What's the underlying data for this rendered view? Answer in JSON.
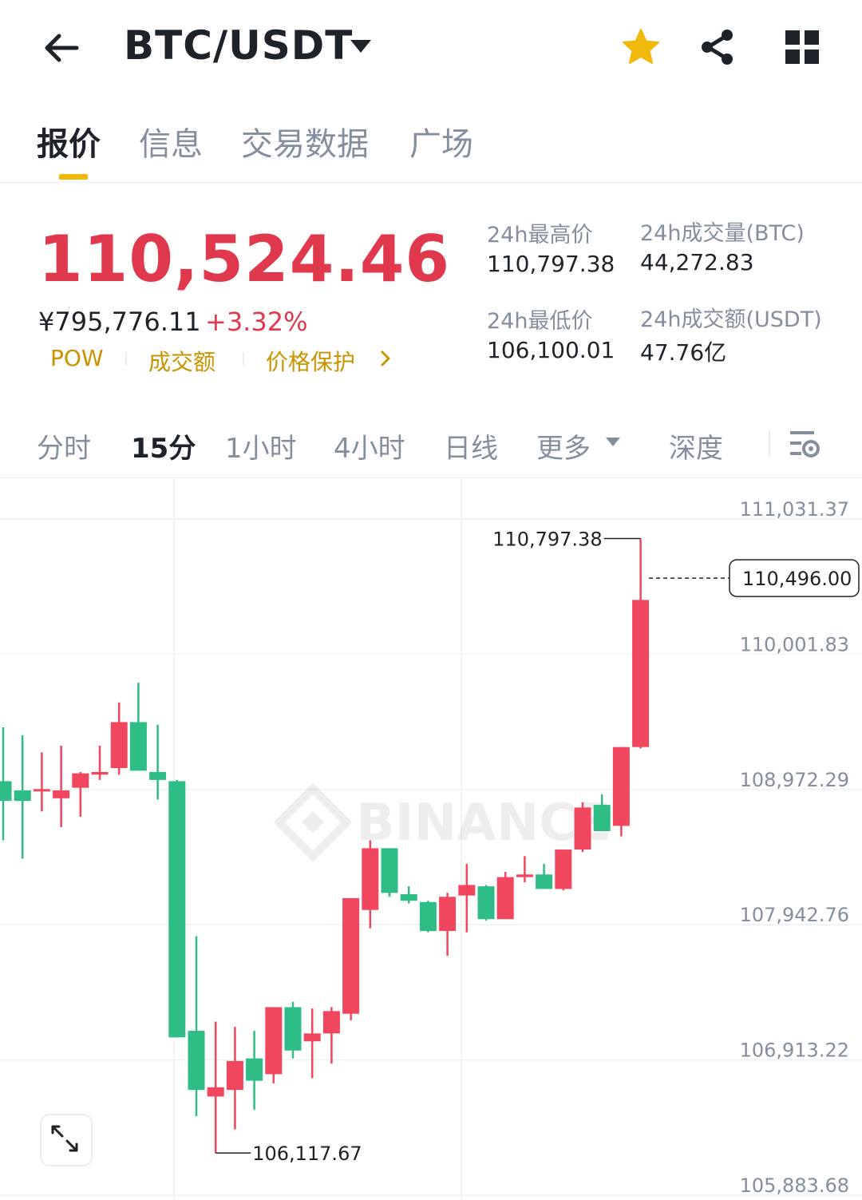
{
  "header": {
    "pair": "BTC/USDT",
    "icons": [
      "back-arrow-icon",
      "dropdown-caret-icon",
      "star-icon",
      "share-icon",
      "grid-menu-icon"
    ],
    "star_color": "#f0b90b"
  },
  "tabs": [
    "报价",
    "信息",
    "交易数据",
    "广场"
  ],
  "active_tab": "报价",
  "quote": {
    "price": "110,524.46",
    "cny": "¥795,776.11",
    "change": "+3.32%",
    "tags": [
      "POW",
      "成交额",
      "价格保护"
    ]
  },
  "stats": {
    "high_label": "24h最高价",
    "high_value": "110,797.38",
    "low_label": "24h最低价",
    "low_value": "106,100.01",
    "vol_btc_label": "24h成交量(BTC)",
    "vol_btc_value": "44,272.83",
    "vol_usdt_label": "24h成交额(USDT)",
    "vol_usdt_value": "47.76亿"
  },
  "intervals": [
    "分时",
    "15分",
    "1小时",
    "4小时",
    "日线",
    "更多",
    "深度"
  ],
  "active_interval": "15分",
  "colors": {
    "up": "#f0475e",
    "down": "#2ebd85",
    "price": "#e0394d",
    "accent": "#f0b90b",
    "tag": "#c99400"
  },
  "chart_data": {
    "type": "candlestick",
    "watermark": "BINANCE",
    "y_ticks": [
      "111,031.37",
      "110,001.83",
      "108,972.29",
      "107,942.76",
      "106,913.22",
      "105,883.68"
    ],
    "y_tick_values": [
      111031.37,
      110001.83,
      108972.29,
      107942.76,
      106913.22,
      105883.68
    ],
    "high_marker": "110,797.38",
    "low_marker": "106,117.67",
    "current_price": "110,496.00",
    "current_price_value": 110496.0,
    "candles": [
      {
        "o": 108950,
        "h": 109360,
        "l": 108500,
        "c": 108800
      },
      {
        "o": 108880,
        "h": 109300,
        "l": 108360,
        "c": 108800
      },
      {
        "o": 108880,
        "h": 109170,
        "l": 108720,
        "c": 108890
      },
      {
        "o": 108820,
        "h": 109220,
        "l": 108600,
        "c": 108880
      },
      {
        "o": 108900,
        "h": 109020,
        "l": 108680,
        "c": 109010
      },
      {
        "o": 109000,
        "h": 109220,
        "l": 108960,
        "c": 109020
      },
      {
        "o": 109050,
        "h": 109550,
        "l": 109000,
        "c": 109400
      },
      {
        "o": 109400,
        "h": 109700,
        "l": 109030,
        "c": 109030
      },
      {
        "o": 109020,
        "h": 109380,
        "l": 108810,
        "c": 108960
      },
      {
        "o": 108950,
        "h": 108960,
        "l": 107000,
        "c": 107000
      },
      {
        "o": 107050,
        "h": 107770,
        "l": 106400,
        "c": 106600
      },
      {
        "o": 106550,
        "h": 107120,
        "l": 106120,
        "c": 106620
      },
      {
        "o": 106600,
        "h": 107080,
        "l": 106300,
        "c": 106820
      },
      {
        "o": 106840,
        "h": 107050,
        "l": 106450,
        "c": 106670
      },
      {
        "o": 106720,
        "h": 107150,
        "l": 106650,
        "c": 107230
      },
      {
        "o": 107230,
        "h": 107270,
        "l": 106840,
        "c": 106900
      },
      {
        "o": 106970,
        "h": 107220,
        "l": 106690,
        "c": 107030
      },
      {
        "o": 107030,
        "h": 107230,
        "l": 106800,
        "c": 107200
      },
      {
        "o": 107180,
        "h": 108060,
        "l": 107130,
        "c": 108060
      },
      {
        "o": 107970,
        "h": 108500,
        "l": 107830,
        "c": 108440
      },
      {
        "o": 108440,
        "h": 108400,
        "l": 108070,
        "c": 108100
      },
      {
        "o": 108090,
        "h": 108150,
        "l": 108020,
        "c": 108040
      },
      {
        "o": 108030,
        "h": 108040,
        "l": 107800,
        "c": 107810
      },
      {
        "o": 107810,
        "h": 108100,
        "l": 107620,
        "c": 108070
      },
      {
        "o": 108080,
        "h": 108320,
        "l": 107800,
        "c": 108160
      },
      {
        "o": 108150,
        "h": 108160,
        "l": 107890,
        "c": 107900
      },
      {
        "o": 107900,
        "h": 108260,
        "l": 107900,
        "c": 108220
      },
      {
        "o": 108220,
        "h": 108380,
        "l": 108180,
        "c": 108240
      },
      {
        "o": 108240,
        "h": 108320,
        "l": 108130,
        "c": 108130
      },
      {
        "o": 108130,
        "h": 108430,
        "l": 108120,
        "c": 108430
      },
      {
        "o": 108430,
        "h": 108790,
        "l": 108410,
        "c": 108750
      },
      {
        "o": 108770,
        "h": 108850,
        "l": 108570,
        "c": 108570
      },
      {
        "o": 108610,
        "h": 109210,
        "l": 108530,
        "c": 109210
      },
      {
        "o": 109210,
        "h": 110797.38,
        "l": 109200,
        "c": 110330
      }
    ]
  }
}
